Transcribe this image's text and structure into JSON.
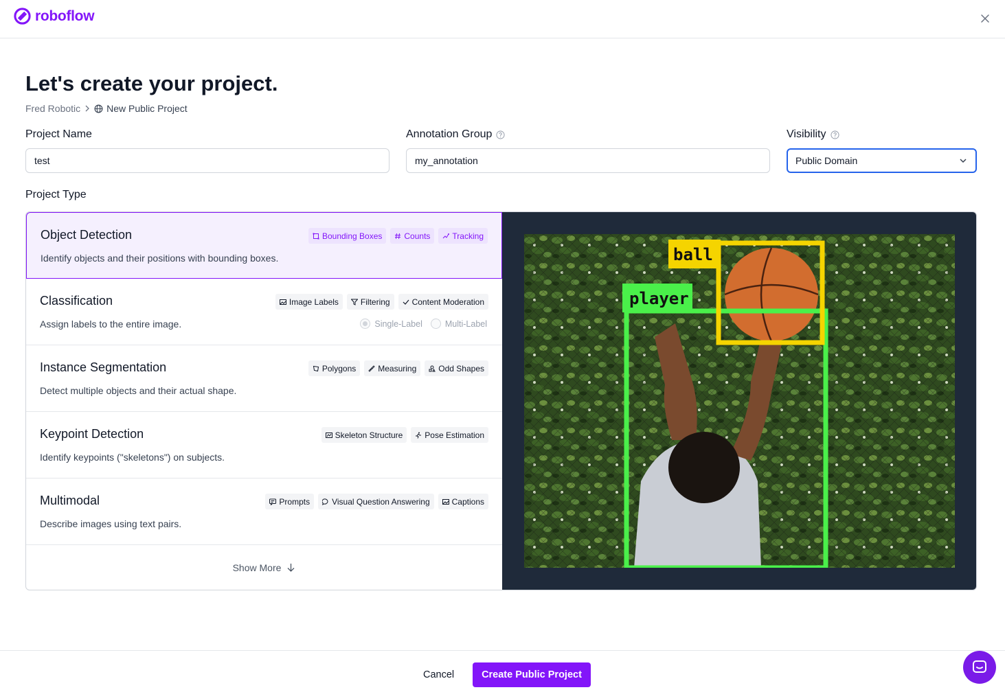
{
  "brand": {
    "name": "roboflow",
    "accent": "#8315f9"
  },
  "page": {
    "title": "Let's create your project.",
    "breadcrumb": {
      "workspace": "Fred Robotic",
      "current": "New Public Project"
    }
  },
  "form": {
    "project_name": {
      "label": "Project Name",
      "value": "test"
    },
    "annotation_group": {
      "label": "Annotation Group",
      "value": "my_annotation"
    },
    "visibility": {
      "label": "Visibility",
      "value": "Public Domain"
    }
  },
  "project_type": {
    "label": "Project Type",
    "types": [
      {
        "title": "Object Detection",
        "description": "Identify objects and their positions with bounding boxes.",
        "tags": [
          {
            "label": "Bounding Boxes",
            "icon": "bounding-box-icon"
          },
          {
            "label": "Counts",
            "icon": "hash-icon"
          },
          {
            "label": "Tracking",
            "icon": "tracking-icon"
          }
        ]
      },
      {
        "title": "Classification",
        "description": "Assign labels to the entire image.",
        "tags": [
          {
            "label": "Image Labels",
            "icon": "image-icon"
          },
          {
            "label": "Filtering",
            "icon": "filter-icon"
          },
          {
            "label": "Content Moderation",
            "icon": "check-icon"
          }
        ],
        "options": [
          "Single-Label",
          "Multi-Label"
        ]
      },
      {
        "title": "Instance Segmentation",
        "description": "Detect multiple objects and their actual shape.",
        "tags": [
          {
            "label": "Polygons",
            "icon": "polygon-icon"
          },
          {
            "label": "Measuring",
            "icon": "ruler-icon"
          },
          {
            "label": "Odd Shapes",
            "icon": "shapes-icon"
          }
        ]
      },
      {
        "title": "Keypoint Detection",
        "description": "Identify keypoints (\"skeletons\") on subjects.",
        "tags": [
          {
            "label": "Skeleton Structure",
            "icon": "skeleton-icon"
          },
          {
            "label": "Pose Estimation",
            "icon": "running-icon"
          }
        ]
      },
      {
        "title": "Multimodal",
        "description": "Describe images using text pairs.",
        "tags": [
          {
            "label": "Prompts",
            "icon": "prompt-icon"
          },
          {
            "label": "Visual Question Answering",
            "icon": "chat-bubble-icon"
          },
          {
            "label": "Captions",
            "icon": "image-icon"
          }
        ]
      }
    ],
    "show_more": "Show More",
    "preview": {
      "labels": [
        "ball",
        "player"
      ]
    }
  },
  "footer": {
    "cancel": "Cancel",
    "create": "Create Public Project"
  }
}
